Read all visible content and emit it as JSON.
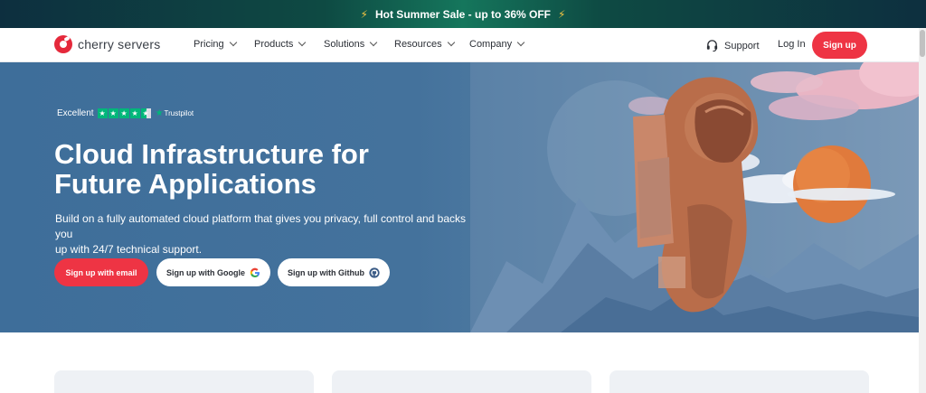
{
  "promo": {
    "icon": "lightning-icon",
    "text": "Hot Summer Sale - up to 36% OFF"
  },
  "nav": {
    "brand": "cherry servers",
    "menu": [
      {
        "label": "Pricing"
      },
      {
        "label": "Products"
      },
      {
        "label": "Solutions"
      },
      {
        "label": "Resources"
      },
      {
        "label": "Company"
      }
    ],
    "support": "Support",
    "login": "Log In",
    "signup": "Sign up"
  },
  "hero": {
    "trustpilot": {
      "rating_word": "Excellent",
      "stars": 4.5,
      "brand": "Trustpilot"
    },
    "title_line1": "Cloud Infrastructure for",
    "title_line2": "Future Applications",
    "subtitle_line1": "Build on a fully automated cloud platform that gives you privacy, full control and backs you",
    "subtitle_line2": "up with 24/7 technical support.",
    "buttons": {
      "email": "Sign up with email",
      "google": "Sign up with Google",
      "github": "Sign up with Github"
    }
  },
  "colors": {
    "accent": "#ee3444",
    "hero_bg": "#44729c",
    "trustpilot_green": "#00b67a"
  }
}
